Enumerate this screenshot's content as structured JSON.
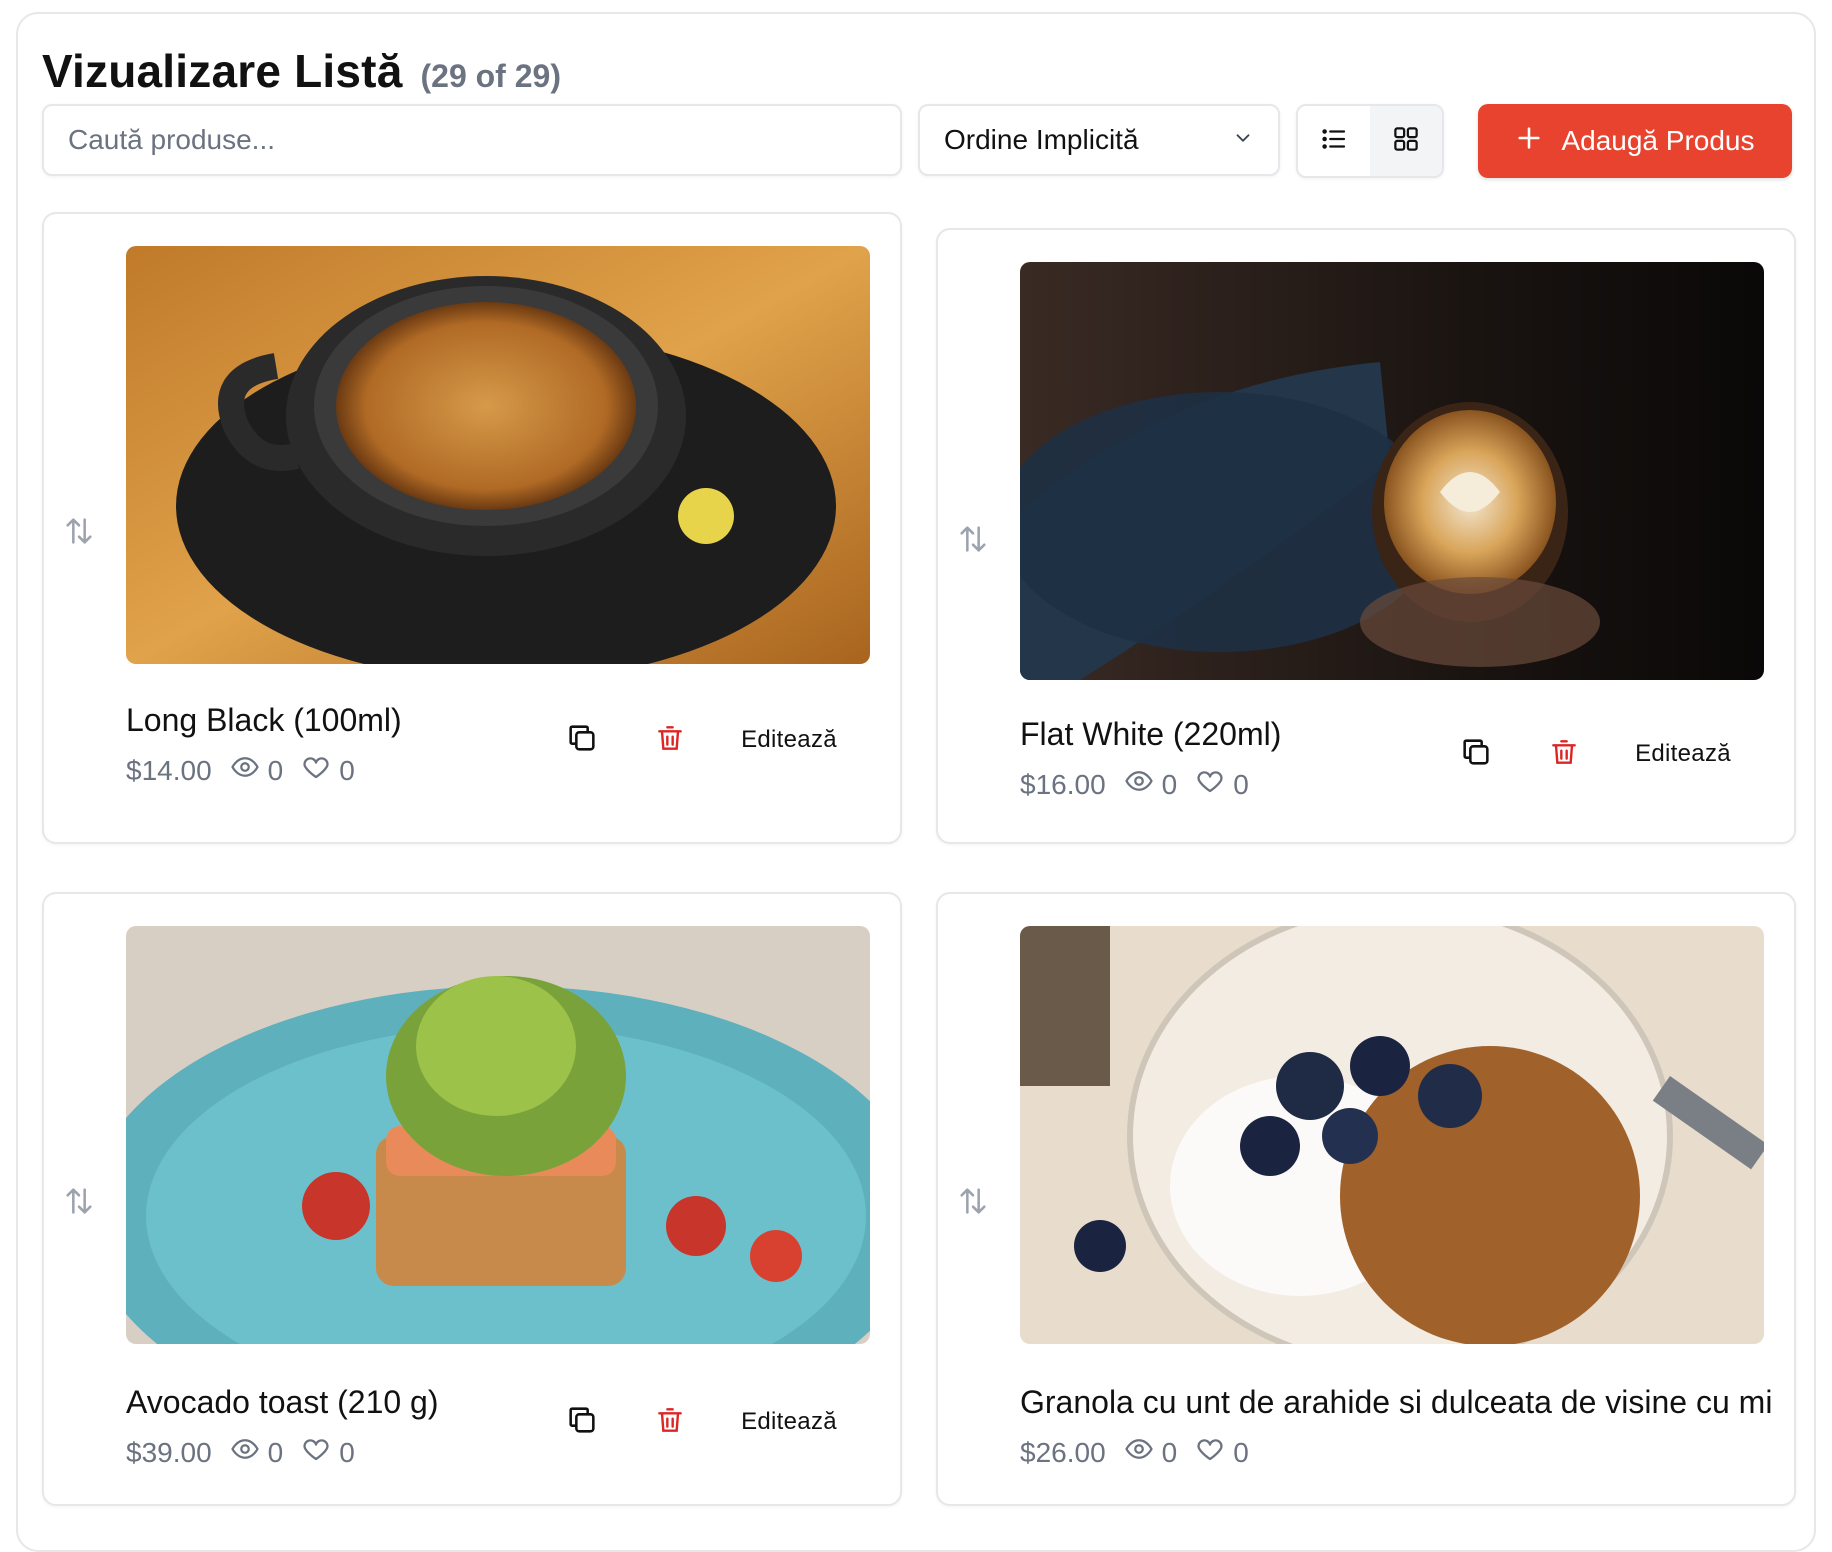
{
  "header": {
    "title": "Vizualizare Listă",
    "count": "(29 of 29)"
  },
  "toolbar": {
    "search_placeholder": "Caută produse...",
    "sort_value": "Ordine Implicită",
    "add_label": "Adaugă Produs"
  },
  "colors": {
    "accent": "#e8432f",
    "delete": "#dc2626",
    "muted": "#6b7280"
  },
  "products": [
    {
      "name": "Long Black (100ml)",
      "price": "$14.00",
      "views": "0",
      "likes": "0",
      "edit_label": "Editează",
      "image": "coffee-cup-photo"
    },
    {
      "name": "Flat White (220ml)",
      "price": "$16.00",
      "views": "0",
      "likes": "0",
      "edit_label": "Editează",
      "image": "latte-art-photo"
    },
    {
      "name": "Avocado toast (210 g)",
      "price": "$39.00",
      "views": "0",
      "likes": "0",
      "edit_label": "Editează",
      "image": "avocado-toast-photo"
    },
    {
      "name": "Granola cu unt de arahide si dulceata de visine cu mi",
      "price": "$26.00",
      "views": "0",
      "likes": "0",
      "edit_label": "Editează",
      "image": "granola-bowl-photo"
    }
  ]
}
